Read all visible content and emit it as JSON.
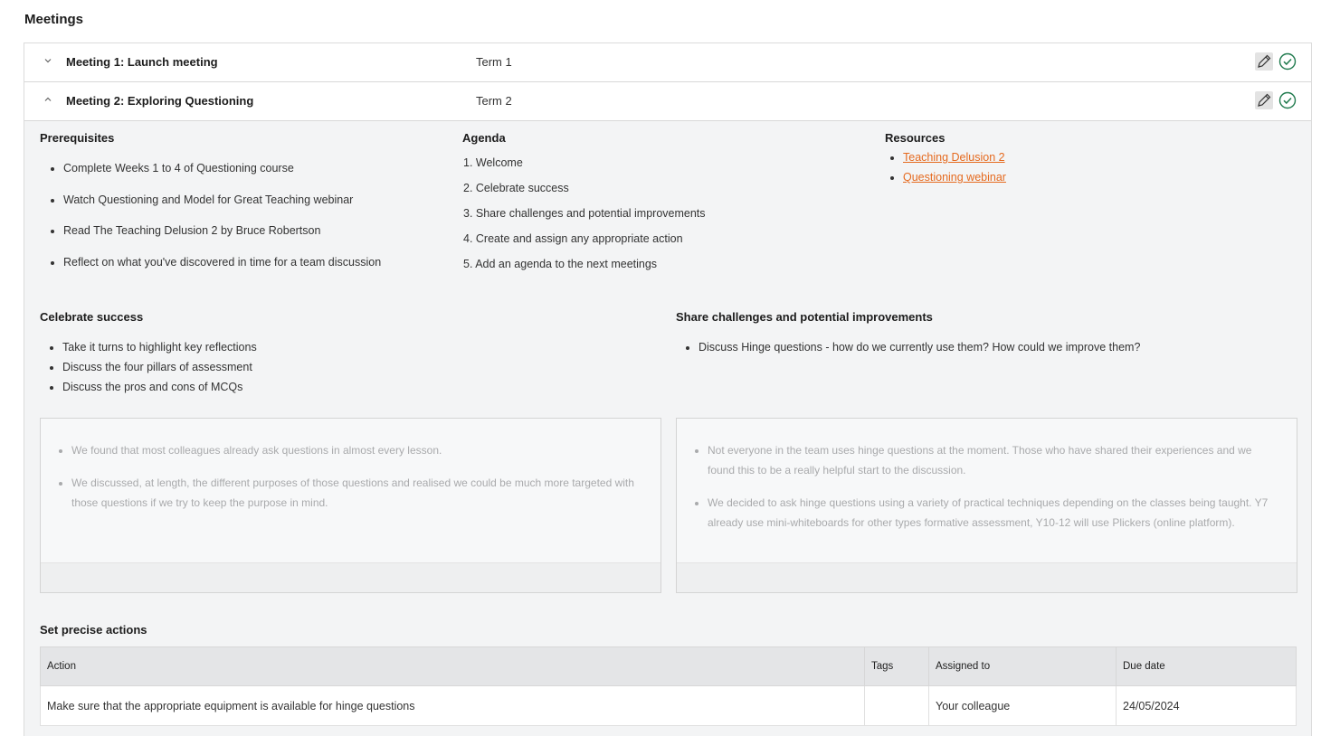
{
  "page": {
    "title": "Meetings"
  },
  "meetings": [
    {
      "title": "Meeting 1: Launch meeting",
      "term": "Term 1",
      "expanded": false
    },
    {
      "title": "Meeting 2: Exploring Questioning",
      "term": "Term 2",
      "expanded": true
    }
  ],
  "details": {
    "prerequisites": {
      "title": "Prerequisites",
      "items": [
        "Complete Weeks 1 to 4 of Questioning course",
        "Watch Questioning and Model for Great Teaching webinar",
        "Read The Teaching Delusion 2 by Bruce Robertson",
        "Reflect on what you've discovered in time for a team discussion"
      ]
    },
    "agenda": {
      "title": "Agenda",
      "items": [
        "1. Welcome",
        "2. Celebrate success",
        "3. Share challenges and potential improvements",
        "4. Create and assign any appropriate action",
        "5. Add an agenda to the next meetings"
      ]
    },
    "resources": {
      "title": "Resources",
      "links": [
        "Teaching Delusion 2",
        "Questioning webinar"
      ]
    },
    "celebrate": {
      "title": "Celebrate success",
      "items": [
        "Take it turns to highlight key reflections",
        "Discuss the four pillars of assessment",
        "Discuss the pros and cons of MCQs"
      ],
      "notes": [
        "We found that most colleagues already ask questions in almost every lesson.",
        "We discussed, at length, the different purposes of those questions and realised we could be much more targeted with those questions if we try to keep the purpose in mind."
      ]
    },
    "challenges": {
      "title": "Share challenges and potential improvements",
      "items": [
        "Discuss Hinge questions - how do we currently use them? How could we improve them?"
      ],
      "notes": [
        "Not everyone in the team uses hinge questions at the moment. Those who have shared their experiences and we found this to be a really helpful start to the discussion.",
        "We decided to ask hinge questions using a variety of practical techniques depending on the classes being taught. Y7 already use mini-whiteboards for other types formative assessment, Y10-12 will use Plickers (online platform)."
      ]
    },
    "actions": {
      "title": "Set precise actions",
      "columns": [
        "Action",
        "Tags",
        "Assigned to",
        "Due date"
      ],
      "rows": [
        {
          "action": "Make sure that the appropriate equipment is available for hinge questions",
          "tags": "",
          "assigned": "Your colleague",
          "due": "24/05/2024"
        }
      ]
    }
  },
  "icons": {
    "edit": "pencil-icon",
    "complete": "check-circle-icon",
    "accent": "#e56a1f",
    "check_color": "#1f7a4d"
  }
}
